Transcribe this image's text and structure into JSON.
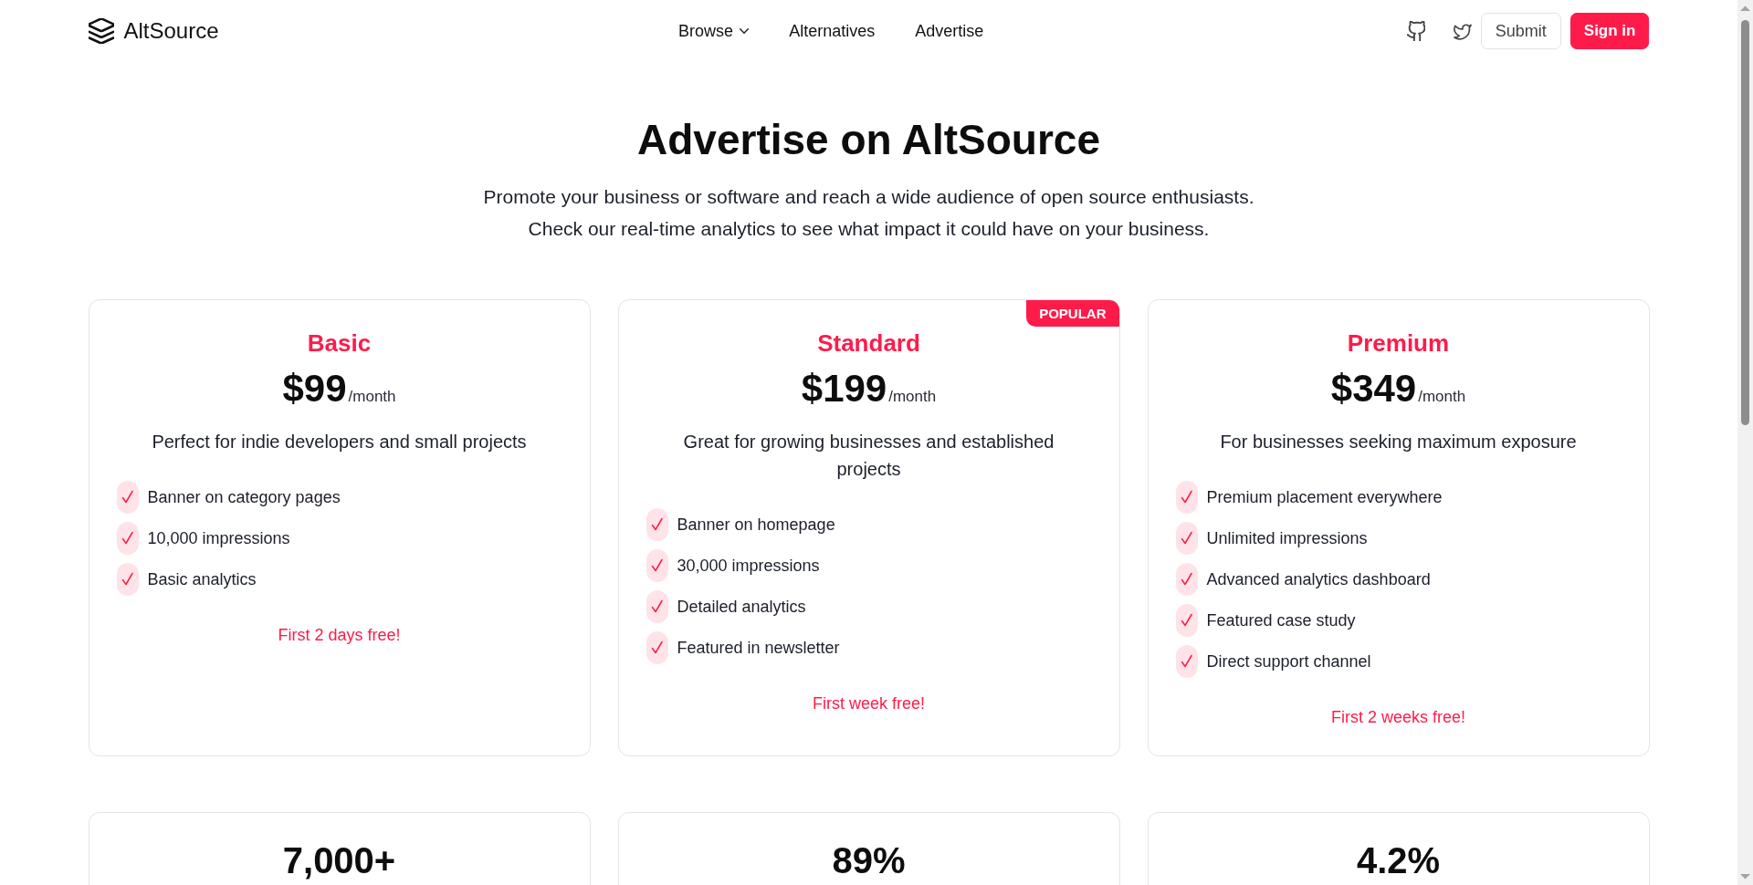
{
  "header": {
    "logo": {
      "text": "AltSource"
    },
    "nav": [
      {
        "label": "Browse",
        "kind": "dropdown"
      },
      {
        "label": "Alternatives",
        "kind": "link"
      },
      {
        "label": "Advertise",
        "kind": "link"
      }
    ],
    "social": [
      {
        "kind": "github"
      },
      {
        "kind": "twitter"
      }
    ],
    "buttons": [
      {
        "label": "Submit",
        "kind": "secondary"
      },
      {
        "label": "Sign in",
        "kind": "primary"
      }
    ]
  },
  "hero": {
    "title": "Advertise on AltSource",
    "subtitle": [
      "Promote your business or software and reach a wide audience of open source enthusiasts.",
      "Check our real-time analytics to see what impact it could have on your business."
    ]
  },
  "plans": [
    {
      "name": "Basic",
      "price": "$99",
      "period": "/month",
      "description": "Perfect for indie developers and small projects",
      "features": [
        "Banner on category pages",
        "10,000 impressions",
        "Basic analytics"
      ],
      "offer": "First 2 days free!"
    },
    {
      "name": "Standard",
      "badge": "POPULAR",
      "price": "$199",
      "period": "/month",
      "description": "Great for growing businesses and established projects",
      "features": [
        "Banner on homepage",
        "30,000 impressions",
        "Detailed analytics",
        "Featured in newsletter"
      ],
      "offer": "First week free!"
    },
    {
      "name": "Premium",
      "price": "$349",
      "period": "/month",
      "description": "For businesses seeking maximum exposure",
      "features": [
        "Premium placement everywhere",
        "Unlimited impressions",
        "Advanced analytics dashboard",
        "Featured case study",
        "Direct support channel"
      ],
      "offer": "First 2 weeks free!"
    }
  ],
  "stats": [
    {
      "value": "7,000+"
    },
    {
      "value": "89%"
    },
    {
      "value": "4.2%"
    }
  ]
}
